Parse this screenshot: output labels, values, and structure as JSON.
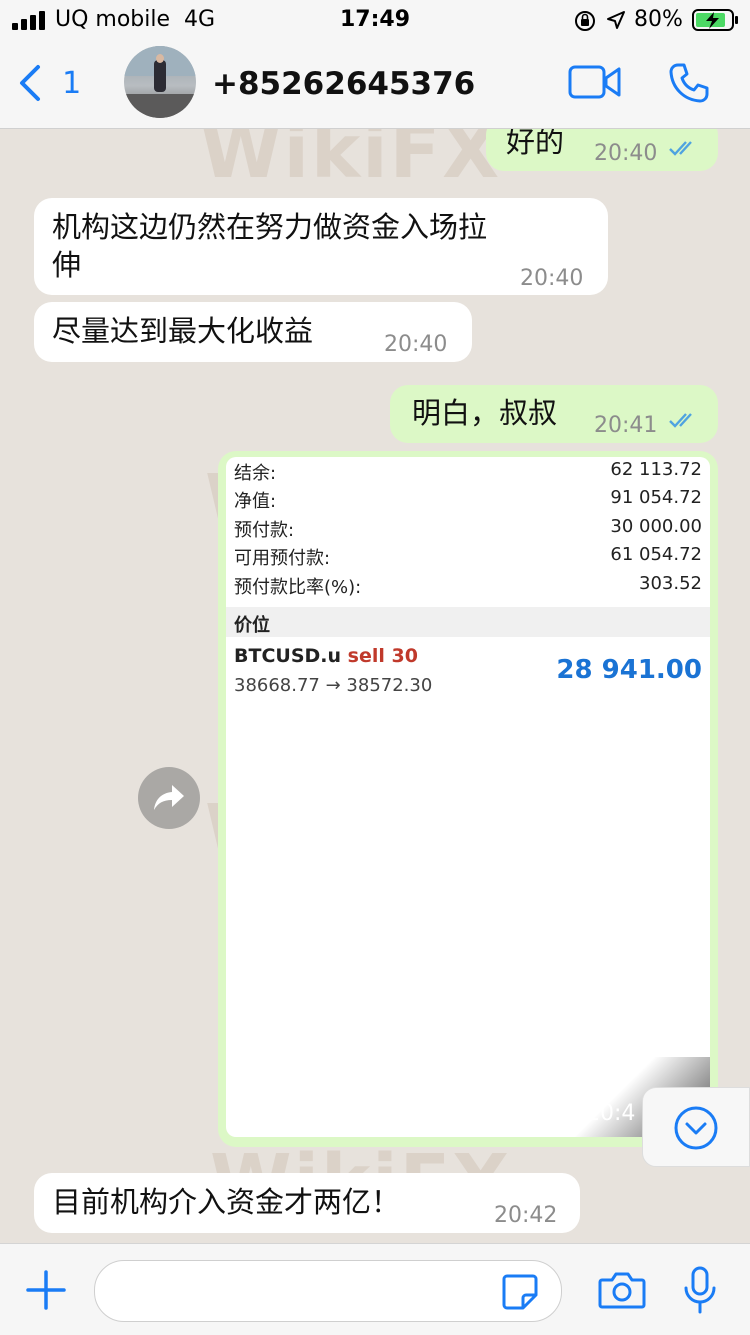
{
  "status_bar": {
    "carrier": "UQ mobile",
    "network": "4G",
    "time": "17:49",
    "battery": "80%"
  },
  "header": {
    "back_count": "1",
    "contact": "+85262645376",
    "icons": [
      "back-chevron-icon",
      "video-call-icon",
      "phone-call-icon"
    ]
  },
  "watermark": "WikiFX",
  "messages": [
    {
      "dir": "out",
      "text": "好的",
      "time": "20:40"
    },
    {
      "dir": "in",
      "line1": "机构这边仍然在努力做资金入场拉",
      "line2": "伸",
      "time": "20:40"
    },
    {
      "dir": "in",
      "text": "尽量达到最大化收益",
      "time": "20:40"
    },
    {
      "dir": "out",
      "text": "明白，叔叔",
      "time": "20:41"
    },
    {
      "dir": "in",
      "text": "目前机构介入资金才两亿！",
      "time": "20:42"
    }
  ],
  "screenshot": {
    "rows": [
      {
        "label": "结余:",
        "value": "62 113.72"
      },
      {
        "label": "净值:",
        "value": "91 054.72"
      },
      {
        "label": "预付款:",
        "value": "30 000.00"
      },
      {
        "label": "可用预付款:",
        "value": "61 054.72"
      },
      {
        "label": "预付款比率(%):",
        "value": "303.52"
      }
    ],
    "price_header": "价位",
    "symbol": "BTCUSD.u",
    "side": "sell 30",
    "range": "38668.77 → 38572.30",
    "price": "28 941.00",
    "time": "20:4"
  },
  "colors": {
    "outgoing_bubble": "#dcf8c6",
    "incoming_bubble": "#ffffff",
    "accent": "#1a7cf5",
    "price": "#1a73d4",
    "sell": "#c0392b"
  }
}
